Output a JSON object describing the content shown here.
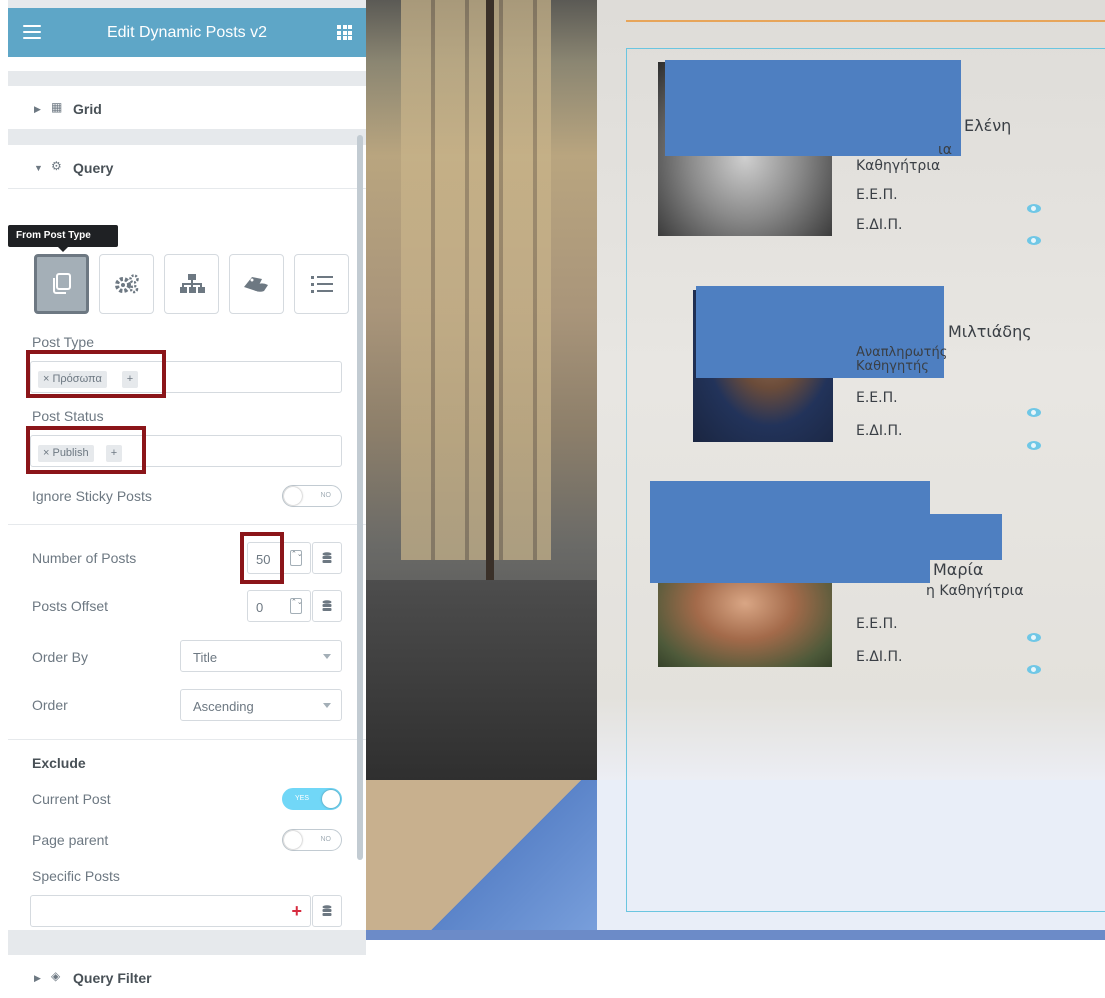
{
  "panel": {
    "title": "Edit Dynamic Posts v2",
    "icons": {
      "menu": "hamburger-icon",
      "apps": "grid-apps-icon"
    },
    "sections": {
      "grid": {
        "label": "Grid",
        "icon": "grid-icon"
      },
      "query": {
        "label": "Query",
        "icon": "query-gear-icon"
      },
      "query_filter": {
        "label": "Query Filter",
        "icon": "layers-icon"
      }
    },
    "tooltip": "From Post Type",
    "query_buttons": [
      {
        "name": "from-post-type",
        "icon": "copy-icon",
        "active": true
      },
      {
        "name": "custom-query",
        "icon": "cogs-icon",
        "active": false
      },
      {
        "name": "related",
        "icon": "sitemap-icon",
        "active": false
      },
      {
        "name": "manual",
        "icon": "tag-hand-icon",
        "active": false
      },
      {
        "name": "list",
        "icon": "list-icon",
        "active": false
      }
    ],
    "post_type": {
      "label": "Post Type",
      "chip": "× Πρόσωπα",
      "add": "+"
    },
    "post_status": {
      "label": "Post Status",
      "chip": "× Publish",
      "add": "+"
    },
    "ignore_sticky": {
      "label": "Ignore Sticky Posts",
      "toggle": "NO"
    },
    "number_of_posts": {
      "label": "Number of Posts",
      "value": "50",
      "spin": "⌃⌄"
    },
    "posts_offset": {
      "label": "Posts Offset",
      "value": "0",
      "spin": "⌃⌄"
    },
    "order_by": {
      "label": "Order By",
      "value": "Title"
    },
    "order": {
      "label": "Order",
      "value": "Ascending"
    },
    "exclude": {
      "heading": "Exclude",
      "current_post": {
        "label": "Current Post",
        "toggle": "YES"
      },
      "page_parent": {
        "label": "Page parent",
        "toggle": "NO"
      },
      "specific_posts": {
        "label": "Specific Posts",
        "add": "+"
      }
    },
    "collapse": "‹",
    "highlight_color": "#8b1519",
    "accent_color": "#5ea6c7"
  },
  "preview": {
    "people": [
      {
        "name": "Ελένη",
        "title_part": "ια",
        "title": "Καθηγήτρια",
        "link1": "Ε.Ε.Π.",
        "link2": "Ε.ΔΙ.Π."
      },
      {
        "name": "Μιλτιάδης",
        "title": "Αναπληρωτής Καθηγητής",
        "link1": "Ε.Ε.Π.",
        "link2": "Ε.ΔΙ.Π."
      },
      {
        "name": "Μαρία",
        "title": "η Καθηγήτρια",
        "link1": "Ε.Ε.Π.",
        "link2": "Ε.ΔΙ.Π."
      }
    ],
    "redaction_color": "#4e7fc1",
    "icon": "eye-icon"
  }
}
